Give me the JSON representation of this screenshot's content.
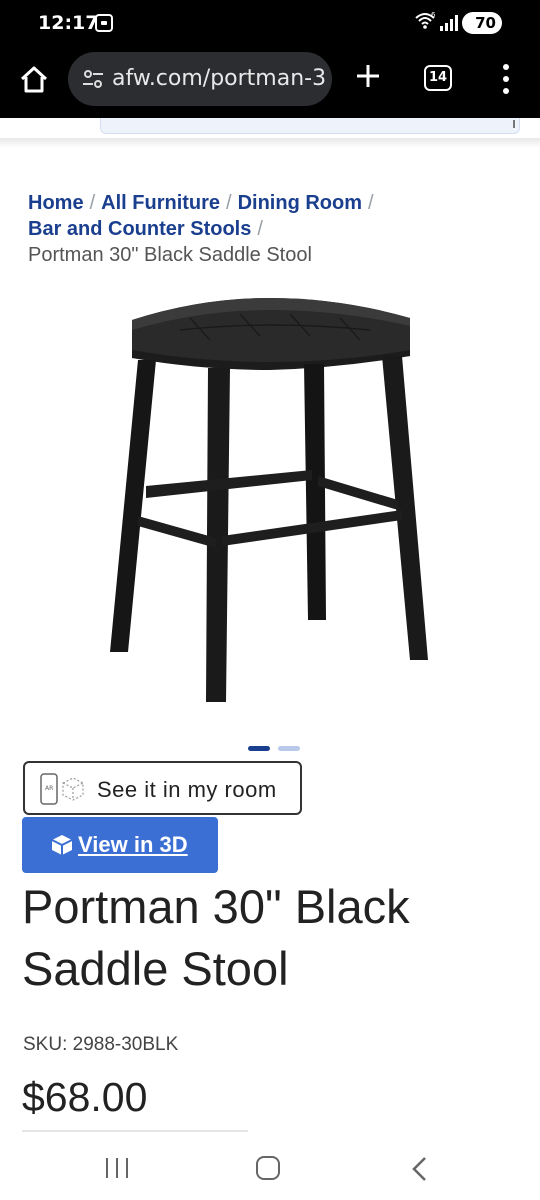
{
  "status_bar": {
    "time": "12:17",
    "battery": "70"
  },
  "browser": {
    "url": "afw.com/portman-3",
    "tab_count": "14"
  },
  "breadcrumb": {
    "items": [
      "Home",
      "All Furniture",
      "Dining Room",
      "Bar and Counter Stools"
    ],
    "separator": "/",
    "current": "Portman 30\" Black Saddle Stool"
  },
  "carousel": {
    "total_images": 2,
    "active_index": 0,
    "active_color": "#1b3f8f",
    "inactive_color": "#b9c9ea"
  },
  "ar_button": {
    "label": "See it in my room",
    "icon": "ar-phone-icon"
  },
  "view3d_button": {
    "label": "View in 3D",
    "icon": "cube-icon",
    "color": "#3b6fd4"
  },
  "product": {
    "title": "Portman 30\" Black Saddle Stool",
    "sku": "SKU: 2988-30BLK",
    "price": "$68.00"
  },
  "colors": {
    "link": "#1b3f8f",
    "text": "#222222"
  }
}
